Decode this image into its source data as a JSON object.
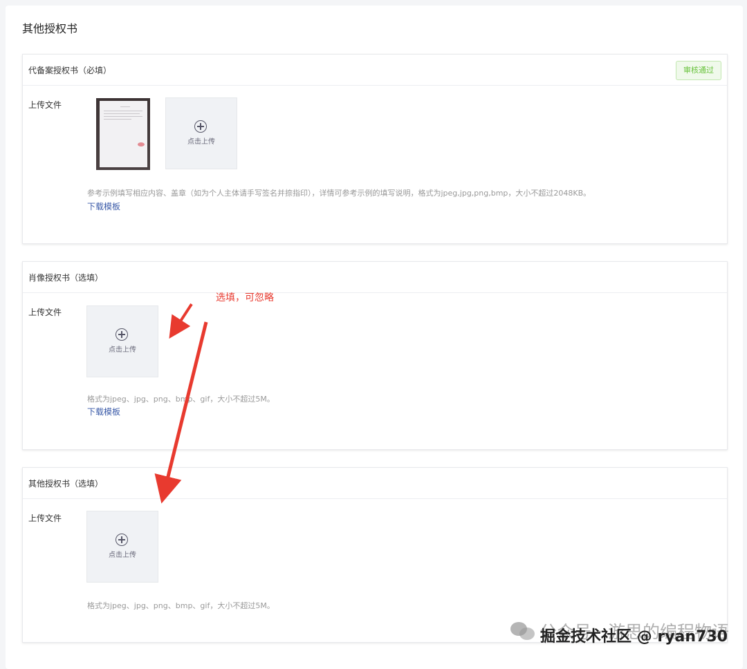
{
  "page": {
    "title": "其他授权书"
  },
  "sections": [
    {
      "title": "代备案授权书（必填）",
      "status": "审核通过",
      "upload_label": "上传文件",
      "upload_text": "点击上传",
      "hint": "参考示例填写相应内容、盖章（如为个人主体请手写签名并捺指印），详情可参考示例的填写说明，格式为jpeg,jpg,png,bmp，大小不超过2048KB。",
      "link": "下载模板"
    },
    {
      "title": "肖像授权书（选填）",
      "upload_label": "上传文件",
      "upload_text": "点击上传",
      "hint": "格式为jpeg、jpg、png、bmp、gif，大小不超过5M。",
      "link": "下载模板"
    },
    {
      "title": "其他授权书（选填）",
      "upload_label": "上传文件",
      "upload_text": "点击上传",
      "hint": "格式为jpeg、jpg、png、bmp、gif，大小不超过5M。"
    }
  ],
  "annotation": {
    "text": "选填，可忽略",
    "color": "#e83a2f"
  },
  "watermark": {
    "primary": "公众号 · 游思的编程物语",
    "secondary": "掘金技术社区 @ ryan730"
  },
  "colors": {
    "accent_green": "#67c23a",
    "link_blue": "#3a5aa8",
    "annotation_red": "#e83a2f"
  }
}
